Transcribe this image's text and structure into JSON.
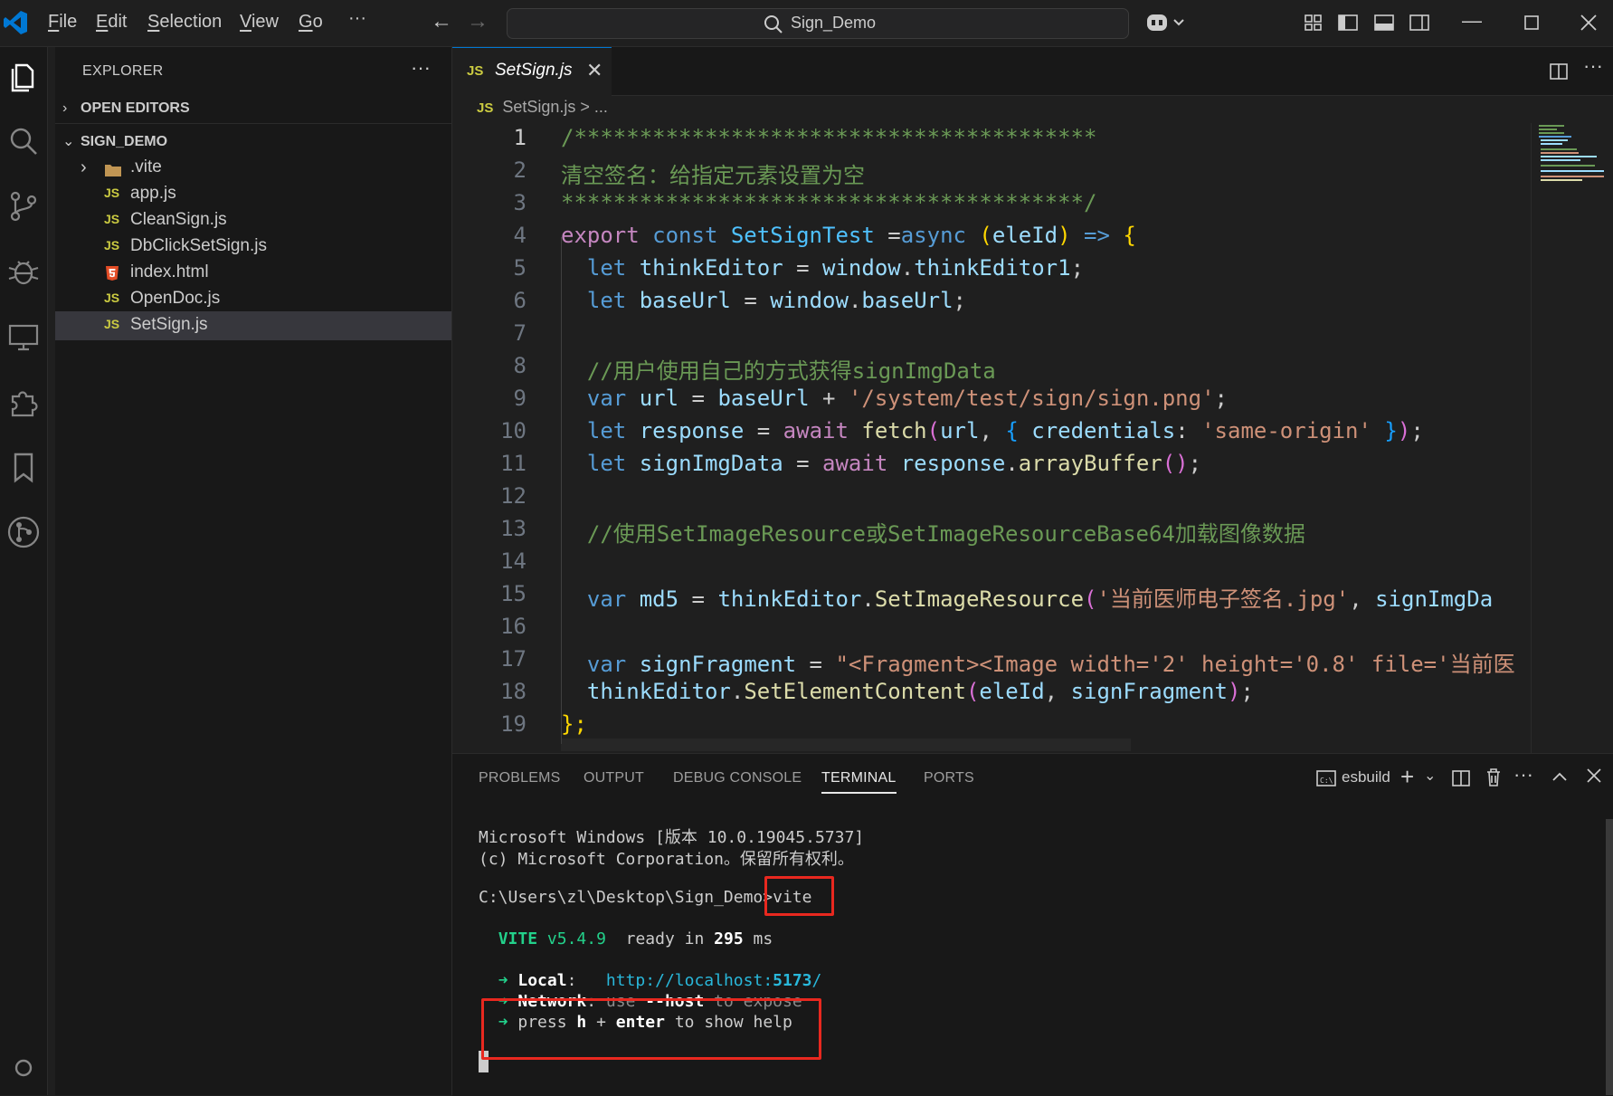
{
  "titlebar": {
    "menus": [
      "File",
      "Edit",
      "Selection",
      "View",
      "Go"
    ],
    "more": "···",
    "search_text": "Sign_Demo"
  },
  "sidebar": {
    "title": "EXPLORER",
    "more": "···",
    "open_editors": "OPEN EDITORS",
    "project": "SIGN_DEMO",
    "items": [
      {
        "icon": "folder",
        "label": ".vite"
      },
      {
        "icon": "JS",
        "label": "app.js"
      },
      {
        "icon": "JS",
        "label": "CleanSign.js"
      },
      {
        "icon": "JS",
        "label": "DbClickSetSign.js"
      },
      {
        "icon": "html5",
        "label": "index.html"
      },
      {
        "icon": "JS",
        "label": "OpenDoc.js"
      },
      {
        "icon": "JS",
        "label": "SetSign.js"
      }
    ]
  },
  "editor": {
    "tab_icon": "JS",
    "tab_label": "SetSign.js",
    "breadcrumb_icon": "JS",
    "breadcrumb_file": "SetSign.js",
    "breadcrumb_rest": "> ...",
    "line_numbers": [
      "1",
      "2",
      "3",
      "4",
      "5",
      "6",
      "7",
      "8",
      "9",
      "10",
      "11",
      "12",
      "13",
      "14",
      "15",
      "16",
      "17",
      "18",
      "19"
    ],
    "code": {
      "l1": "/****************************************",
      "l2": "清空签名：给指定元素设置为空",
      "l3": "****************************************/",
      "l4_export": "export",
      "l4_const": "const",
      "l4_name": "SetSignTest",
      "l4_eq": " =",
      "l4_async": "async",
      "l4_param": "eleId",
      "l4_arrow": "=>",
      "l5_let": "let",
      "l5_var": "thinkEditor",
      "l5_win": "window",
      "l5_prop": "thinkEditor1",
      "l6_let": "let",
      "l6_var": "baseUrl",
      "l6_win": "window",
      "l6_prop": "baseUrl",
      "l8": "//用户使用自己的方式获得signImgData",
      "l9_var": "var",
      "l9_name": "url",
      "l9_base": "baseUrl",
      "l9_str": "'/system/test/sign/sign.png'",
      "l10_let": "let",
      "l10_name": "response",
      "l10_await": "await",
      "l10_fn": "fetch",
      "l10_url": "url",
      "l10_key": "credentials",
      "l10_str": "'same-origin'",
      "l11_let": "let",
      "l11_name": "signImgData",
      "l11_await": "await",
      "l11_obj": "response",
      "l11_fn": "arrayBuffer",
      "l13": "//使用SetImageResource或SetImageResourceBase64加载图像数据",
      "l15_var": "var",
      "l15_name": "md5",
      "l15_obj": "thinkEditor",
      "l15_fn": "SetImageResource",
      "l15_str": "'当前医师电子签名.jpg'",
      "l15_arg": "signImgDa",
      "l17_var": "var",
      "l17_name": "signFragment",
      "l17_str": "\"<Fragment><Image width='2' height='0.8' file='当前医",
      "l18_obj": "thinkEditor",
      "l18_fn": "SetElementContent",
      "l18_a1": "eleId",
      "l18_a2": "signFragment",
      "l19": "};"
    }
  },
  "panel": {
    "tabs": [
      "PROBLEMS",
      "OUTPUT",
      "DEBUG CONSOLE",
      "TERMINAL",
      "PORTS"
    ],
    "active_tab": "TERMINAL",
    "terminal_name": "esbuild",
    "terminal": {
      "line1": "Microsoft Windows [版本 10.0.19045.5737]",
      "line2": "(c) Microsoft Corporation。保留所有权利。",
      "prompt": "C:\\Users\\zl\\Desktop\\Sign_Demo>",
      "command": "vite",
      "vite_label": "VITE",
      "vite_version": "v5.4.9",
      "ready_text": "ready in",
      "ready_ms": "295",
      "ms": "ms",
      "arrow": "➜",
      "local_label": "Local",
      "local_url_pre": "http://localhost:",
      "local_port": "5173",
      "local_url_post": "/",
      "network_label": "Network",
      "network_text": "use",
      "network_flag": "--host",
      "network_tail": "to expose",
      "press": "press",
      "key_h": "h",
      "plus": "+",
      "key_enter": "enter",
      "help_tail": "to show help"
    }
  }
}
